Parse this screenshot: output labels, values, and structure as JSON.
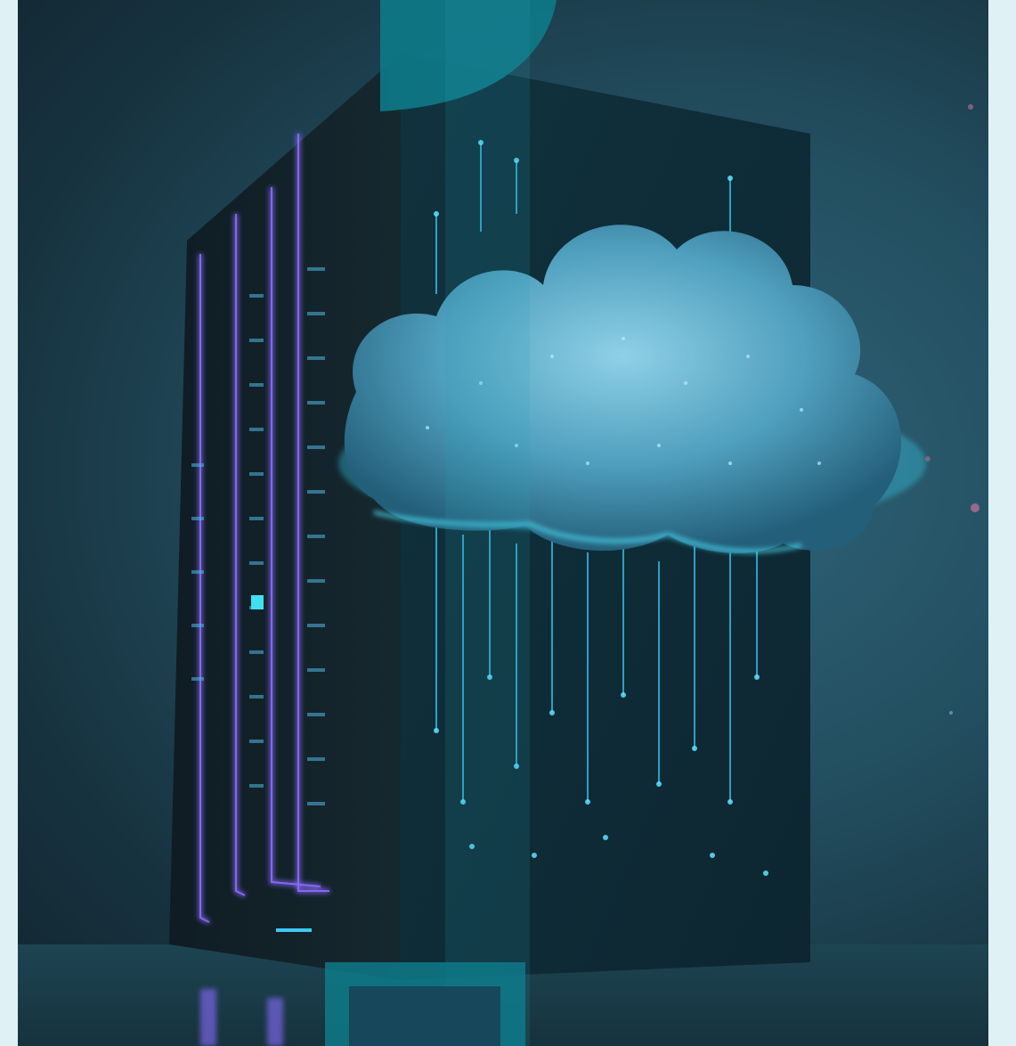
{
  "image": {
    "kind": "illustration",
    "subject": "server-tower-with-glowing-cloud",
    "colors": {
      "background": "#1b3b48",
      "accent_teal": "#0e7a88",
      "glow_cyan": "#39d2f2",
      "rack_violet": "#8a6cff",
      "panel_light": "#dff1f5"
    }
  }
}
